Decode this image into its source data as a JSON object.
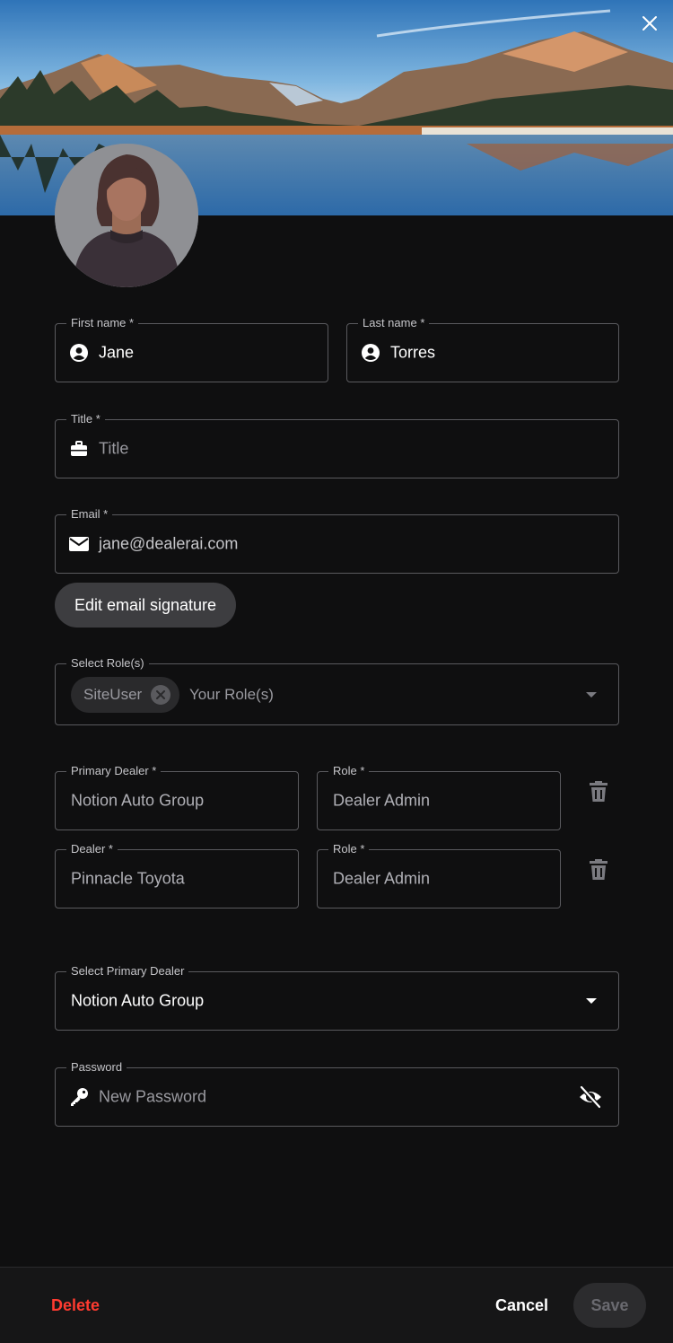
{
  "header": {
    "close_icon": "close-icon"
  },
  "form": {
    "first_name": {
      "label": "First name *",
      "value": "Jane",
      "icon": "user-circle-icon"
    },
    "last_name": {
      "label": "Last name *",
      "value": "Torres",
      "icon": "user-circle-icon"
    },
    "title": {
      "label": "Title *",
      "placeholder": "Title",
      "icon": "briefcase-icon"
    },
    "email": {
      "label": "Email *",
      "value": "jane@dealerai.com",
      "icon": "envelope-icon"
    },
    "edit_signature_label": "Edit email signature",
    "roles": {
      "label": "Select Role(s)",
      "chip": "SiteUser",
      "placeholder": "Your Role(s)"
    },
    "dealers": [
      {
        "dealer_label": "Primary Dealer *",
        "dealer_value": "Notion Auto Group",
        "role_label": "Role *",
        "role_value": "Dealer Admin"
      },
      {
        "dealer_label": "Dealer *",
        "dealer_value": "Pinnacle Toyota",
        "role_label": "Role *",
        "role_value": "Dealer Admin"
      }
    ],
    "primary_dealer": {
      "label": "Select Primary Dealer",
      "value": "Notion Auto Group"
    },
    "password": {
      "label": "Password",
      "placeholder": "New Password",
      "icon": "key-icon",
      "toggle_icon": "eye-off-icon"
    }
  },
  "footer": {
    "delete_label": "Delete",
    "cancel_label": "Cancel",
    "save_label": "Save"
  },
  "colors": {
    "background": "#0f0f10",
    "delete": "#ff3b30",
    "field_border": "#5a5a5e",
    "button_bg": "#3d3d40"
  }
}
